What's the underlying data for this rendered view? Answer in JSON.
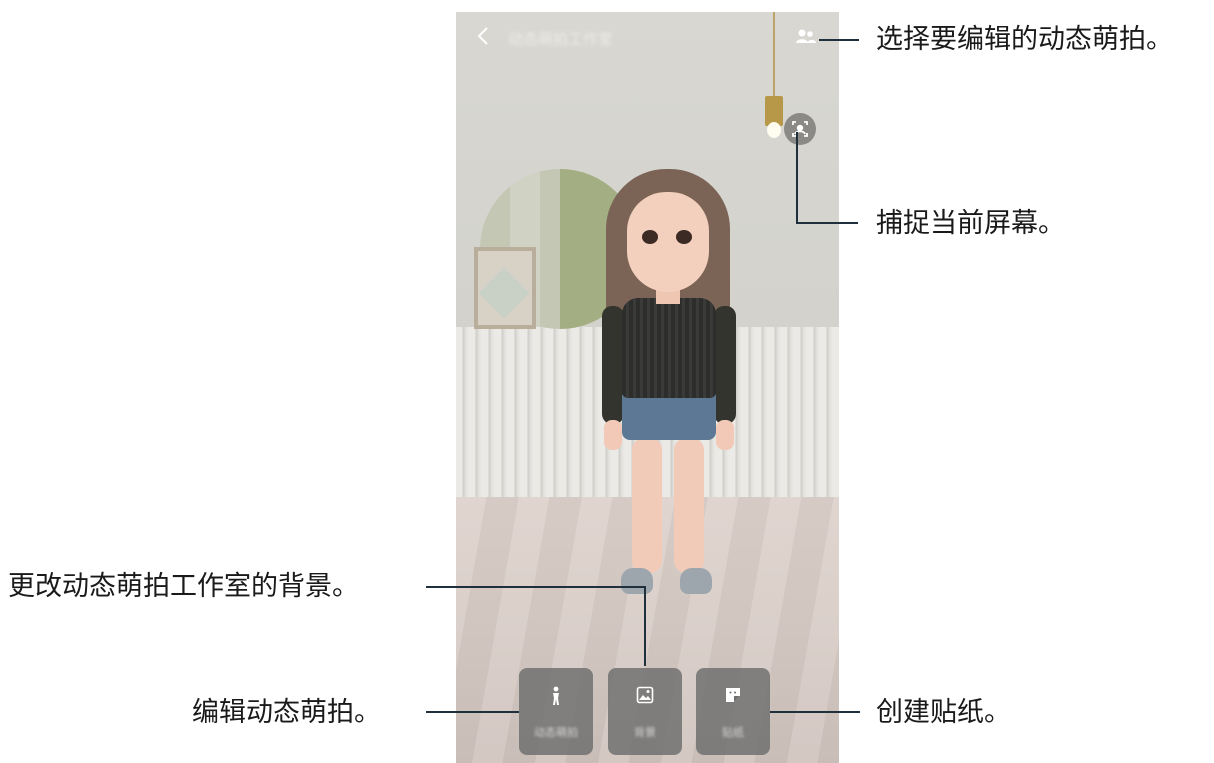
{
  "screen": {
    "title": "动态萌拍工作室",
    "icons": {
      "back": "chevron-left-icon",
      "select_emoji": "people-icon",
      "capture": "capture-icon"
    }
  },
  "tiles": [
    {
      "label": "动态萌拍",
      "icon": "person-icon"
    },
    {
      "label": "背景",
      "icon": "image-icon"
    },
    {
      "label": "贴纸",
      "icon": "sticker-icon"
    }
  ],
  "callouts": {
    "select": "选择要编辑的动态萌拍。",
    "capture": "捕捉当前屏幕。",
    "background": "更改动态萌拍工作室的背景。",
    "edit": "编辑动态萌拍。",
    "sticker": "创建贴纸。"
  }
}
